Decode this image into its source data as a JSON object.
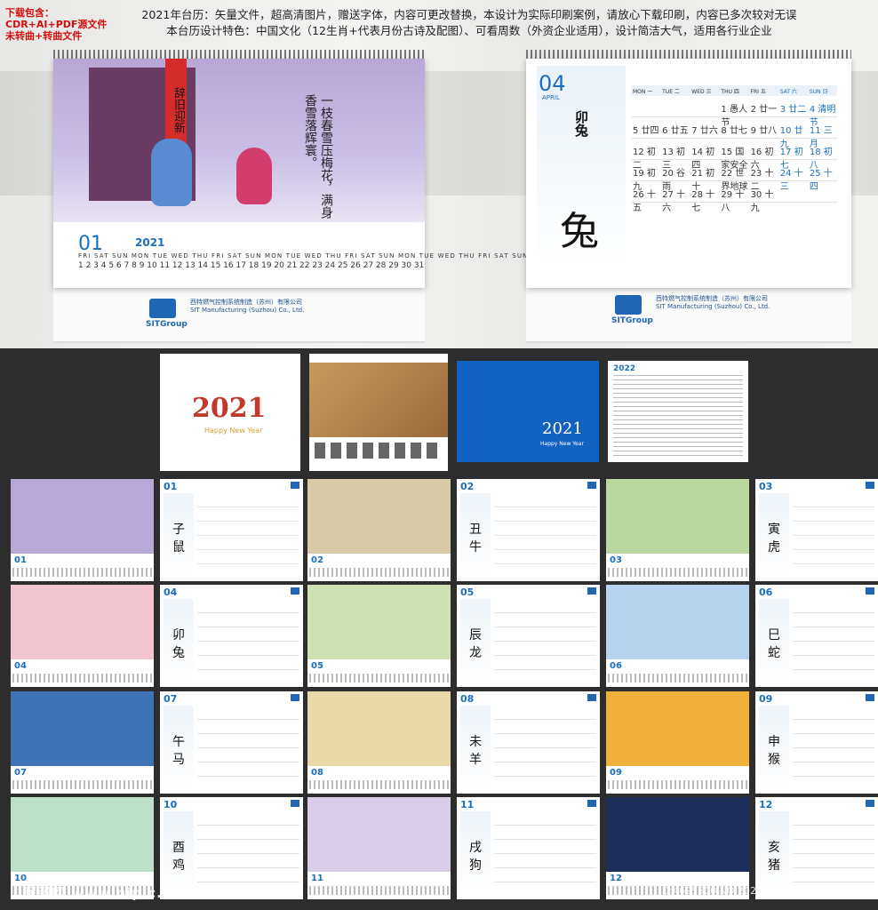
{
  "header": {
    "download_title": "下载包含：",
    "download_items": [
      "CDR+AI+PDF源文件",
      "未转曲+转曲文件"
    ],
    "desc_line1": "2021年台历：矢量文件，超高清图片，赠送字体，内容可更改替换，本设计为实际印刷案例，请放心下载印刷，内容已多次较对无误",
    "desc_line2": "本台历设计特色：中国文化（12生肖+代表月份古诗及配图）、可看周数（外资企业适用），设计简洁大气，适用各行业企业"
  },
  "cal_left": {
    "couplet": "辞旧迎新",
    "poem": "一枝春雪压梅花，满身香雪落辉寰。",
    "month": "01",
    "year": "2021",
    "weekdays": "FRI SAT SUN MON TUE WED THU FRI SAT SUN MON TUE WED THU FRI SAT SUN MON TUE WED THU FRI SAT SUN MON TUE WED THU FRI SAT SUN",
    "dates": "1 2 3 4 5 6 7 8 9 10 11 12 13 14 15 16 17 18 19 20 21 22 23 24 25 26 27 28 29 30 31",
    "company_cn": "西特燃气控制系统制造（苏州）有限公司",
    "company_en": "SIT Manufacturing (Suzhou) Co., Ltd.",
    "logo": "SITGroup"
  },
  "cal_right": {
    "month": "04",
    "month_en": "APRIL",
    "title": "卯兔",
    "big_char": "兔",
    "weekdays": [
      "MON 一",
      "TUE 二",
      "WED 三",
      "THU 四",
      "FRI 五",
      "SAT 六",
      "SUN 日"
    ],
    "weeks": [
      [
        "",
        "",
        "",
        "1 愚人节",
        "2 廿一",
        "3 廿二",
        "4 清明节"
      ],
      [
        "5 廿四",
        "6 廿五",
        "7 廿六",
        "8 廿七",
        "9 廿八",
        "10 廿九",
        "11 三月"
      ],
      [
        "12 初二",
        "13 初三",
        "14 初四",
        "15 国家安全",
        "16 初六",
        "17 初七",
        "18 初八"
      ],
      [
        "19 初九",
        "20 谷雨",
        "21 初十",
        "22 世界地球",
        "23 十二",
        "24 十三",
        "25 十四"
      ],
      [
        "26 十五",
        "27 十六",
        "28 十七",
        "29 十八",
        "30 十九",
        "",
        ""
      ]
    ],
    "company_cn": "西特燃气控制系统制造（苏州）有限公司",
    "company_en": "SIT Manufacturing (Suzhou) Co., Ltd.",
    "logo": "SITGroup"
  },
  "thumbs": {
    "cover_text": "2021",
    "cover_sub": "Happy New Year",
    "blue_text": "2021",
    "blue_sub": "Happy New Year",
    "year_2022": "2022",
    "months": [
      "01",
      "02",
      "03",
      "04",
      "05",
      "06",
      "07",
      "08",
      "09",
      "10",
      "11",
      "12"
    ],
    "zodiac": [
      "子鼠",
      "丑牛",
      "寅虎",
      "卯兔",
      "辰龙",
      "巳蛇",
      "午马",
      "未羊",
      "申猴",
      "酉鸡",
      "戌狗",
      "亥猪"
    ]
  },
  "footer": {
    "watermark": "昵图网 www.nipic.com",
    "id": "ID:4695500 NO:20201126225542913034"
  }
}
